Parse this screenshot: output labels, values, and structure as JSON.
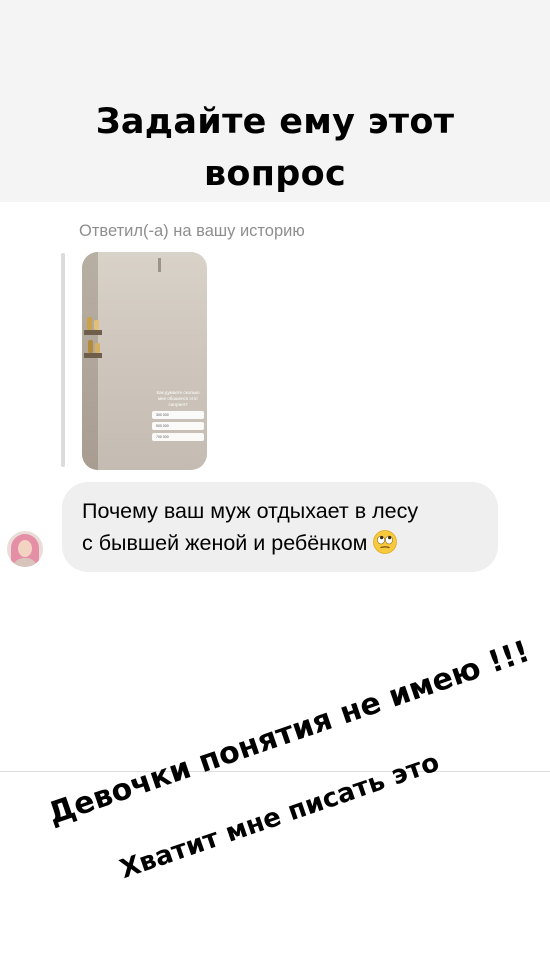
{
  "banner": {
    "title_line1": "Задайте ему этот",
    "title_line2": "вопрос"
  },
  "reply": {
    "context_label": "Ответил(-а) на вашу историю"
  },
  "story_thumbnail": {
    "poll_question": "Как думаете сколько мне обошелся этот санузел?",
    "poll_options": [
      "300 000",
      "500 000",
      "700 000"
    ]
  },
  "message": {
    "line1": "Почему ваш муж отдыхает в лесу",
    "line2": "с бывшей женой и ребёнком",
    "emoji": "face-with-rolling-eyes"
  },
  "captions": {
    "line1": "Девочки понятия не имею !!!",
    "line2": "Хватит мне писать это"
  }
}
